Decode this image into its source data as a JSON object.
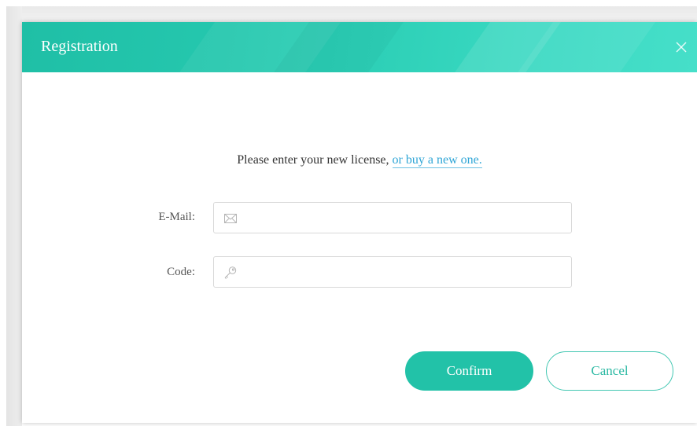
{
  "dialog": {
    "title": "Registration",
    "close_icon": "close-icon"
  },
  "intro": {
    "text": "Please enter your new license, ",
    "link_text": "or buy a new one."
  },
  "form": {
    "email": {
      "label": "E-Mail:",
      "value": "",
      "placeholder": "",
      "icon": "envelope-icon"
    },
    "code": {
      "label": "Code:",
      "value": "",
      "placeholder": "",
      "icon": "key-icon"
    }
  },
  "buttons": {
    "confirm_label": "Confirm",
    "cancel_label": "Cancel"
  },
  "colors": {
    "accent": "#22c2a8",
    "link": "#2ea5d6"
  }
}
